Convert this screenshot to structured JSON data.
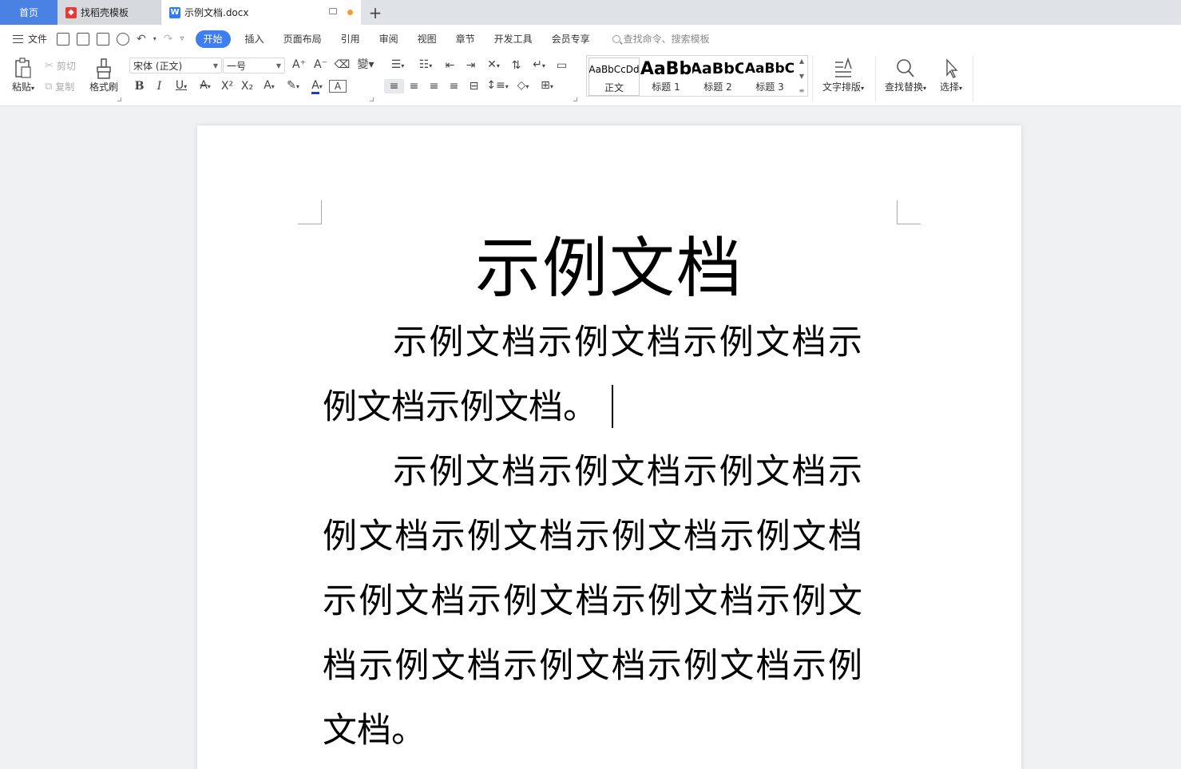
{
  "tabs": {
    "home": "首页",
    "templates": "找稻壳模板",
    "document": "示例文档.docx",
    "add": "+"
  },
  "menu": {
    "file": "文件",
    "tabs": [
      "开始",
      "插入",
      "页面布局",
      "引用",
      "审阅",
      "视图",
      "章节",
      "开发工具",
      "会员专享"
    ],
    "active_tab": "开始",
    "search_placeholder": "查找命令、搜索模板"
  },
  "ribbon": {
    "paste": "粘贴",
    "cut": "剪切",
    "copy": "复制",
    "format_painter": "格式刷",
    "font_name": "宋体 (正文)",
    "font_size": "一号",
    "styles": [
      {
        "preview": "AaBbCcDd",
        "name": "正文"
      },
      {
        "preview": "AaBb",
        "name": "标题 1"
      },
      {
        "preview": "AaBbC",
        "name": "标题 2"
      },
      {
        "preview": "AaBbC",
        "name": "标题 3"
      }
    ],
    "text_layout": "文字排版",
    "find_replace": "查找替换",
    "select": "选择"
  },
  "document": {
    "title": "示例文档",
    "paragraphs": [
      "示例文档示例文档示例文档示例文档示例文档。",
      "示例文档示例文档示例文档示例文档示例文档示例文档示例文档示例文档示例文档示例文档示例文档示例文档示例文档示例文档示例文档。"
    ]
  },
  "colors": {
    "accent": "#3f7ef0",
    "home_tab": "#4a82e4",
    "modified_dot": "#f0a030",
    "font_color_bar": "#1a3cc8"
  }
}
